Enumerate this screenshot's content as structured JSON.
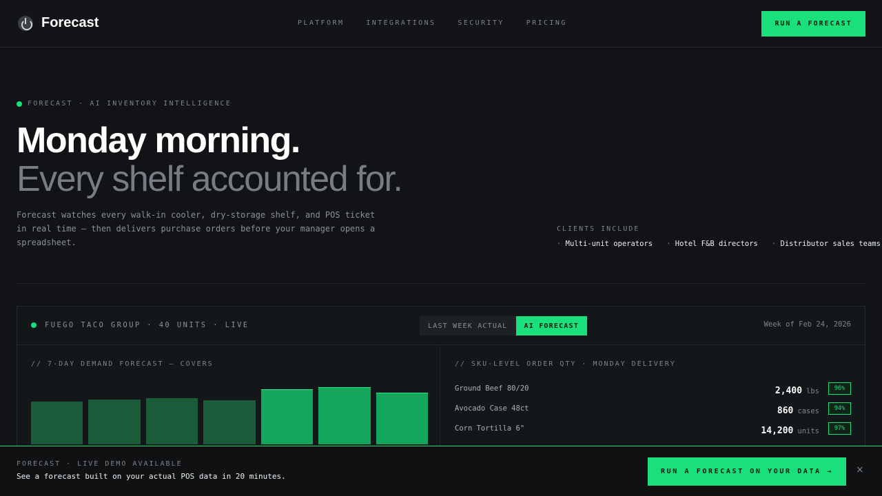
{
  "nav": {
    "brand": "Forecast",
    "links": [
      "PLATFORM",
      "INTEGRATIONS",
      "SECURITY",
      "PRICING"
    ],
    "cta": "RUN A FORECAST"
  },
  "hero": {
    "eyebrow": "FORECAST · AI INVENTORY INTELLIGENCE",
    "headline": "Monday morning.",
    "subheadline": "Every shelf accounted for.",
    "lede": "Forecast watches every walk-in cooler, dry-storage shelf, and POS ticket in real time — then delivers purchase orders before your manager opens a spreadsheet.",
    "clients_label": "CLIENTS INCLUDE",
    "clients": [
      "Multi-unit operators",
      "Hotel F&B directors",
      "Distributor sales teams"
    ]
  },
  "panel": {
    "title": "FUEGO TACO GROUP · 40 UNITS · LIVE",
    "toggle": [
      "LAST WEEK ACTUAL",
      "AI FORECAST"
    ],
    "active_toggle": "AI FORECAST",
    "week": "Week of Feb 24, 2026",
    "demand_title": "// 7-DAY DEMAND FORECAST — COVERS",
    "sku_title": "// SKU-LEVEL ORDER QTY · MONDAY DELIVERY",
    "skus": [
      {
        "name": "Ground Beef 80/20",
        "qty": "2,400",
        "unit": "lbs",
        "confidence": "96%"
      },
      {
        "name": "Avocado Case 48ct",
        "qty": "860",
        "unit": "cases",
        "confidence": "94%"
      },
      {
        "name": "Corn Tortilla 6\"",
        "qty": "14,200",
        "unit": "units",
        "confidence": "97%"
      }
    ]
  },
  "chart_data": {
    "type": "bar",
    "title": "// 7-DAY DEMAND FORECAST — COVERS",
    "values": [
      64,
      67,
      69,
      66,
      83,
      86,
      77
    ],
    "highlighted": [
      false,
      false,
      false,
      false,
      true,
      true,
      true
    ],
    "colors": {
      "normal": "#1a5c3a",
      "highlight": "#13a65c"
    },
    "ylim": [
      0,
      100
    ]
  },
  "banner": {
    "label": "FORECAST · LIVE DEMO AVAILABLE",
    "text": "See a forecast built on your actual POS data in 20 minutes.",
    "cta": "RUN A FORECAST ON YOUR DATA →",
    "close": "×"
  },
  "colors": {
    "accent": "#19e07a",
    "background": "#111316"
  }
}
